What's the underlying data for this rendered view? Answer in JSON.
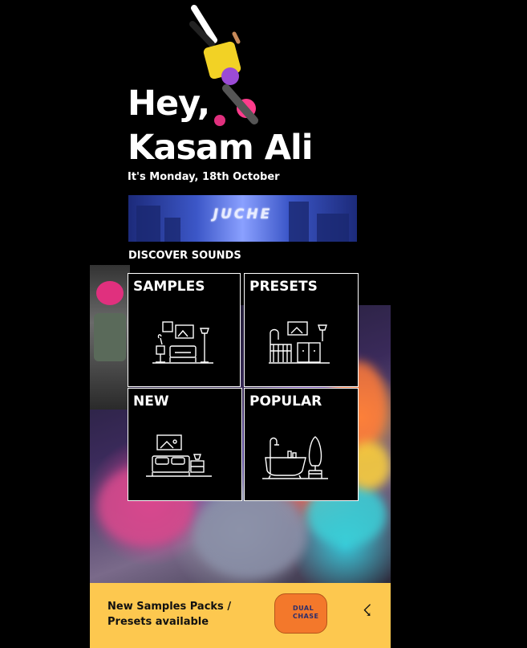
{
  "header": {
    "greeting_line1": "Hey,",
    "greeting_line2": "Kasam Ali",
    "date": "It's Monday, 18th October"
  },
  "banner": {
    "logo_text": "JUCHE"
  },
  "discover": {
    "title": "DISCOVER SOUNDS",
    "cards": [
      {
        "label": "SAMPLES",
        "icon": "living-room-icon"
      },
      {
        "label": "PRESETS",
        "icon": "bedroom-crib-icon"
      },
      {
        "label": "NEW",
        "icon": "bedroom-icon"
      },
      {
        "label": "POPULAR",
        "icon": "bathroom-icon"
      }
    ]
  },
  "footer": {
    "message": "New Samples Packs / Presets available",
    "pack_label": "DUAL CHASE",
    "action_icon": "lightning-icon",
    "background": "#fdc84f"
  }
}
